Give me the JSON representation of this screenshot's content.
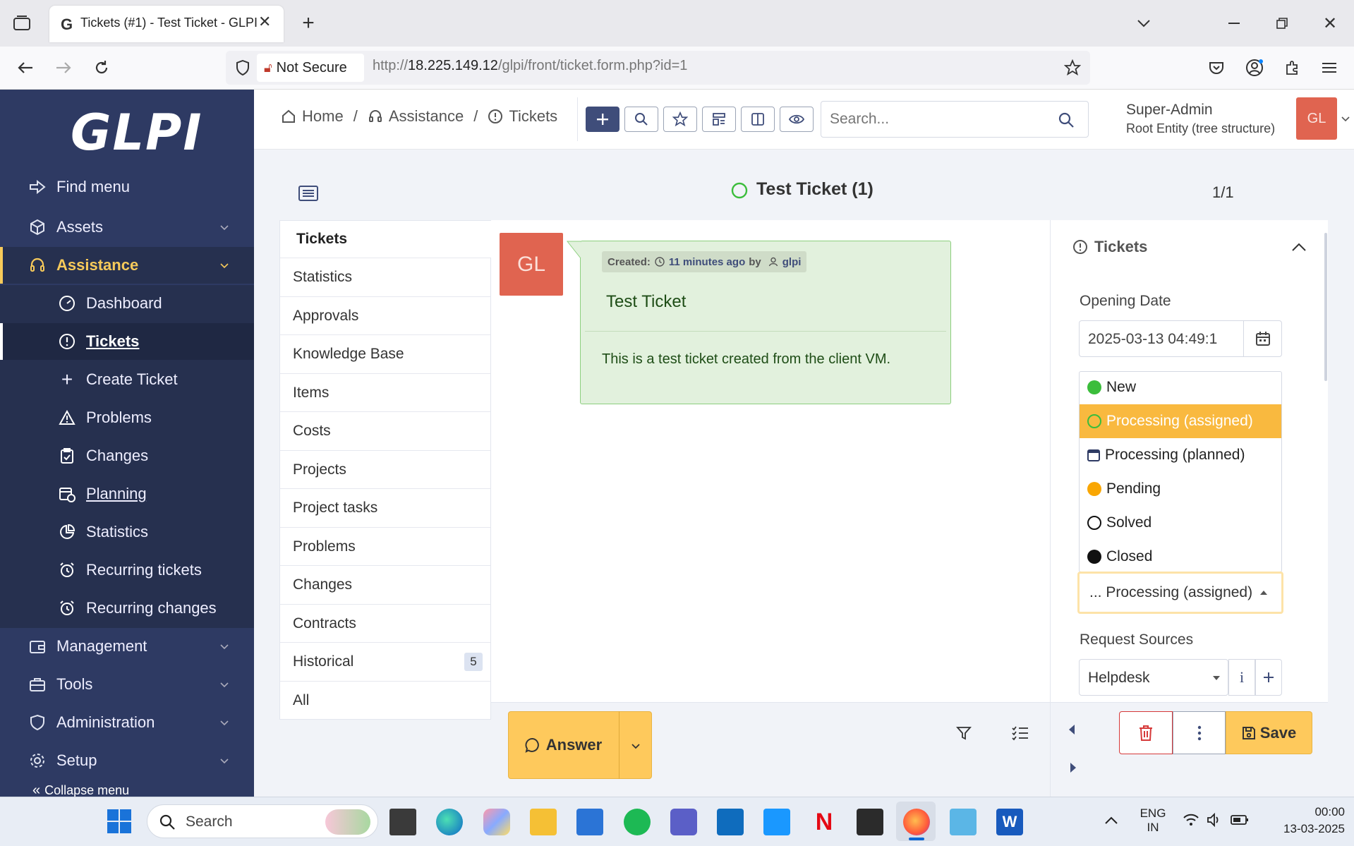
{
  "browser": {
    "tab_title": "Tickets (#1) - Test Ticket - GLPI",
    "security_label": "Not Secure",
    "url_prefix": "http://",
    "url_host": "18.225.149.12",
    "url_path": "/glpi/front/ticket.form.php?id=1"
  },
  "sidebar": {
    "logo": "GLPI",
    "items": [
      {
        "label": "Find menu",
        "icon": "arrow-right-icon"
      },
      {
        "label": "Assets",
        "icon": "box-icon"
      },
      {
        "label": "Assistance",
        "icon": "headset-icon"
      },
      {
        "label": "Dashboard",
        "icon": "gauge-icon"
      },
      {
        "label": "Tickets",
        "icon": "alert-circle-icon"
      },
      {
        "label": "Create Ticket",
        "icon": "plus-icon"
      },
      {
        "label": "Problems",
        "icon": "warning-icon"
      },
      {
        "label": "Changes",
        "icon": "clipboard-check-icon"
      },
      {
        "label": "Planning",
        "icon": "calendar-time-icon"
      },
      {
        "label": "Statistics",
        "icon": "chart-pie-icon"
      },
      {
        "label": "Recurring tickets",
        "icon": "alarm-icon"
      },
      {
        "label": "Recurring changes",
        "icon": "alarm-icon"
      },
      {
        "label": "Management",
        "icon": "wallet-icon"
      },
      {
        "label": "Tools",
        "icon": "briefcase-icon"
      },
      {
        "label": "Administration",
        "icon": "shield-icon"
      },
      {
        "label": "Setup",
        "icon": "gear-icon"
      }
    ],
    "collapse_label": "Collapse menu"
  },
  "breadcrumb": {
    "home": "Home",
    "assistance": "Assistance",
    "tickets": "Tickets",
    "sep": "/"
  },
  "search": {
    "placeholder": "Search..."
  },
  "user": {
    "name": "Super-Admin",
    "entity": "Root Entity (tree structure)",
    "initials": "GL"
  },
  "ticket": {
    "title": "Test Ticket (1)",
    "pager": "1/1",
    "created_label": "Created:",
    "created_time": "11 minutes ago",
    "by_label": "by",
    "author": "glpi",
    "item_title": "Test Ticket",
    "content": "This is a test ticket created from the client VM.",
    "avatar_initials": "GL"
  },
  "tabs": [
    {
      "label": "Tickets",
      "active": true
    },
    {
      "label": "Statistics"
    },
    {
      "label": "Approvals"
    },
    {
      "label": "Knowledge Base"
    },
    {
      "label": "Items"
    },
    {
      "label": "Costs"
    },
    {
      "label": "Projects"
    },
    {
      "label": "Project tasks"
    },
    {
      "label": "Problems"
    },
    {
      "label": "Changes"
    },
    {
      "label": "Contracts"
    },
    {
      "label": "Historical",
      "badge": "5"
    },
    {
      "label": "All"
    }
  ],
  "panel": {
    "header": "Tickets",
    "opening_date_label": "Opening Date",
    "opening_date_value": "2025-03-13 04:49:1",
    "status_options": [
      {
        "label": "New",
        "icon": "status-new-icon"
      },
      {
        "label": "Processing (assigned)",
        "icon": "status-assigned-icon",
        "highlighted": true
      },
      {
        "label": "Processing (planned)",
        "icon": "status-planned-icon"
      },
      {
        "label": "Pending",
        "icon": "status-pending-icon"
      },
      {
        "label": "Solved",
        "icon": "status-solved-icon"
      },
      {
        "label": "Closed",
        "icon": "status-closed-icon"
      }
    ],
    "status_selected": "... Processing (assigned)",
    "request_sources_label": "Request Sources",
    "request_source_value": "Helpdesk",
    "info_label": "i"
  },
  "actions": {
    "answer": "Answer",
    "save": "Save"
  },
  "taskbar": {
    "search_placeholder": "Search",
    "lang_top": "ENG",
    "lang_bottom": "IN",
    "time": "00:00",
    "date": "13-03-2025"
  },
  "colors": {
    "sidebar_bg": "#2e3a63",
    "accent": "#fec95c",
    "avatar": "#e06450",
    "timeline_bg": "#e2f1dd",
    "status_new": "#3bbd3b",
    "status_pending": "#f9a602"
  }
}
